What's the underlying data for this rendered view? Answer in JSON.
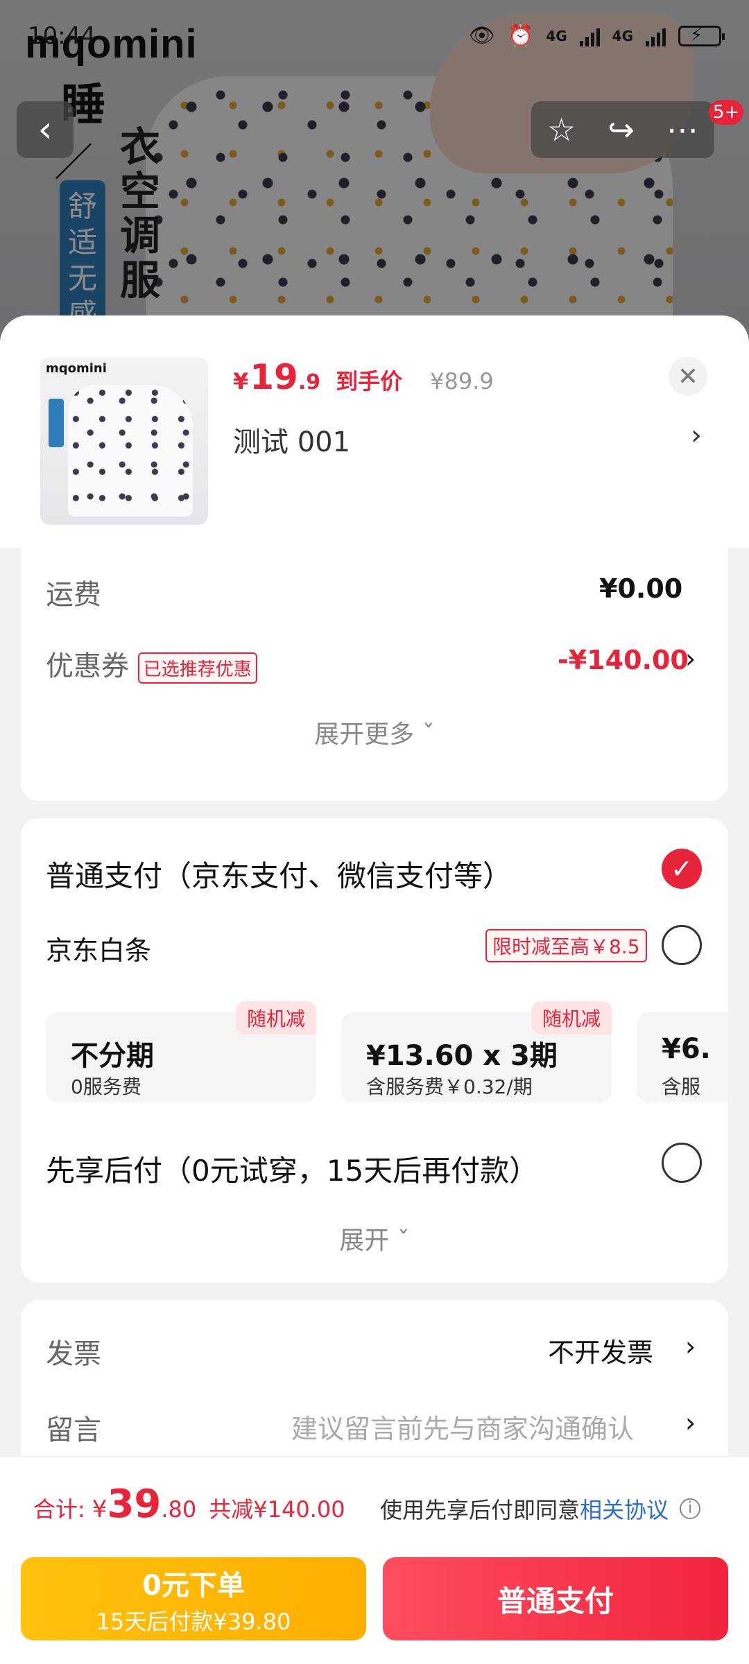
{
  "status": {
    "time": "10:44",
    "net1": "4G",
    "net2": "4G"
  },
  "banner": {
    "logo": "mqomini",
    "vtext1": "睡",
    "slash": "／",
    "vtext2": "衣空调服",
    "tag": "舒适无感"
  },
  "nav": {
    "back_icon": "chevron-left-icon",
    "badge": "5+"
  },
  "product": {
    "thumb_logo": "mqomini",
    "price_currency": "¥",
    "price_int": "19",
    "price_dec": ".9",
    "price_label": "到手价",
    "price_original": "¥89.9",
    "spec": "测试  001"
  },
  "summary": {
    "shipping_label": "运费",
    "shipping_value": "¥0.00",
    "coupon_label": "优惠券",
    "coupon_tag": "已选推荐优惠",
    "coupon_value": "-¥140.00",
    "expand_more": "展开更多 ˇ"
  },
  "payment": {
    "normal_label": "普通支付（京东支付、微信支付等）",
    "baitiao_label": "京东白条",
    "baitiao_promo": "限时减至高￥8.5",
    "installments": [
      {
        "badge": "随机减",
        "main": "不分期",
        "sub": "0服务费"
      },
      {
        "badge": "随机减",
        "main": "¥13.60 x 3期",
        "sub": "含服务费￥0.32/期"
      },
      {
        "badge": "",
        "main": "¥6.",
        "sub": "含服"
      }
    ],
    "later_label": "先享后付（0元试穿，15天后再付款）",
    "expand": "展开 ˇ"
  },
  "extra": {
    "invoice_label": "发票",
    "invoice_value": "不开发票",
    "message_label": "留言",
    "message_placeholder": "建议留言前先与商家沟通确认"
  },
  "bottom": {
    "total_label": "合计:",
    "total_currency": "¥",
    "total_int": "39",
    "total_dec": ".80",
    "total_saved": "共减¥140.00",
    "agree_text": "使用先享后付即同意",
    "agree_link": "相关协议",
    "credit_btn_main": "0元下单",
    "credit_btn_sub": "15天后付款¥39.80",
    "pay_btn": "普通支付"
  },
  "colors": {
    "accent": "#e8243b",
    "link": "#2a6fcf",
    "credit": "#ffb800"
  }
}
